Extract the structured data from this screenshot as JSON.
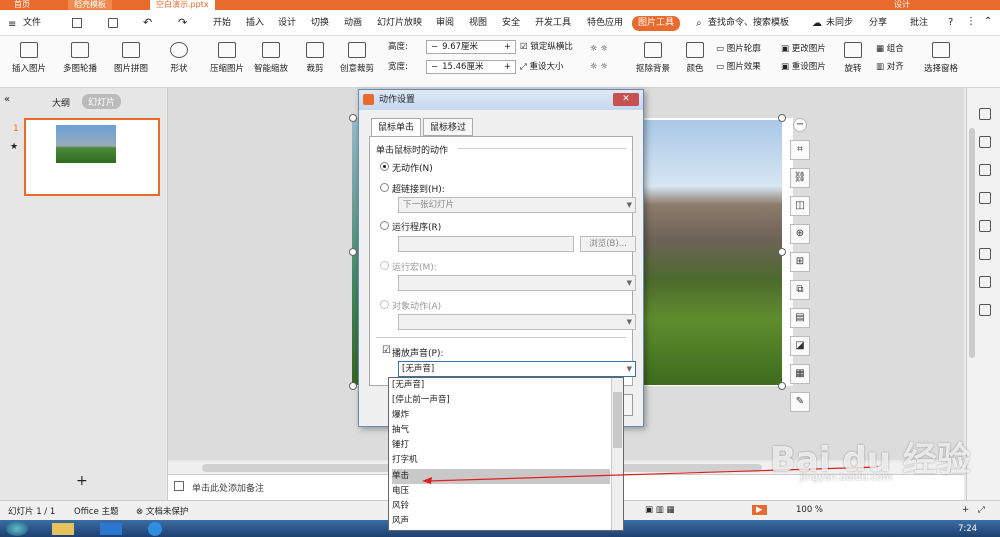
{
  "titlebar": {
    "home": "首页",
    "template": "稻壳模板",
    "doc": "空白演示.pptx",
    "account": "设计"
  },
  "menu": [
    "文件",
    "开始",
    "插入",
    "设计",
    "切换",
    "动画",
    "幻灯片放映",
    "审阅",
    "视图",
    "安全",
    "开发工具",
    "特色应用",
    "图片工具"
  ],
  "menu_right": {
    "search": "查找命令、搜索模板",
    "sync": "未同步",
    "share": "分享",
    "comment": "批注"
  },
  "ribbon": {
    "insert_pic": "插入图片",
    "multi_outline": "多图轮播",
    "collage": "图片拼图",
    "shape": "形状",
    "compress": "压缩图片",
    "smart_zoom": "智能缩放",
    "crop": "裁剪",
    "creative_crop": "创意裁剪",
    "height_label": "高度:",
    "height_val": "9.67厘米",
    "width_label": "宽度:",
    "width_val": "15.46厘米",
    "lock_ratio": "锁定纵横比",
    "reset_size": "重设大小",
    "remove_bg": "抠除背景",
    "color": "颜色",
    "outline": "图片轮廓",
    "effect": "图片效果",
    "change_pic": "更改图片",
    "reset_pic": "重设图片",
    "rotate": "旋转",
    "group": "组合",
    "align": "对齐",
    "select_pane": "选择窗格"
  },
  "leftpanel": {
    "tab_outline": "大纲",
    "tab_slides": "幻灯片",
    "slide_num": "1"
  },
  "notes_placeholder": "单击此处添加备注",
  "status": {
    "slide": "幻灯片 1 / 1",
    "theme": "Office 主题",
    "protect": "文档未保护",
    "zoom": "100 %"
  },
  "dialog": {
    "title": "动作设置",
    "tab_click": "鼠标单击",
    "tab_hover": "鼠标移过",
    "group_label": "单击鼠标时的动作",
    "opt_none": "无动作(N)",
    "opt_link": "超链接到(H):",
    "link_val": "下一张幻灯片",
    "opt_run": "运行程序(R)",
    "browse": "浏览(B)...",
    "opt_macro": "运行宏(M):",
    "opt_object": "对象动作(A)",
    "play_sound": "播放声音(P):",
    "sound_val": "[无声音]"
  },
  "sound_list": [
    "[无声音]",
    "[停止前一声音]",
    "爆炸",
    "抽气",
    "锤打",
    "打字机",
    "单击",
    "电压",
    "风铃",
    "风声"
  ],
  "sound_selected_index": 6,
  "taskbar": {
    "time": "7:24"
  },
  "watermark": {
    "text": "Bai du 经验",
    "url": "jingyan.baidu.com"
  }
}
